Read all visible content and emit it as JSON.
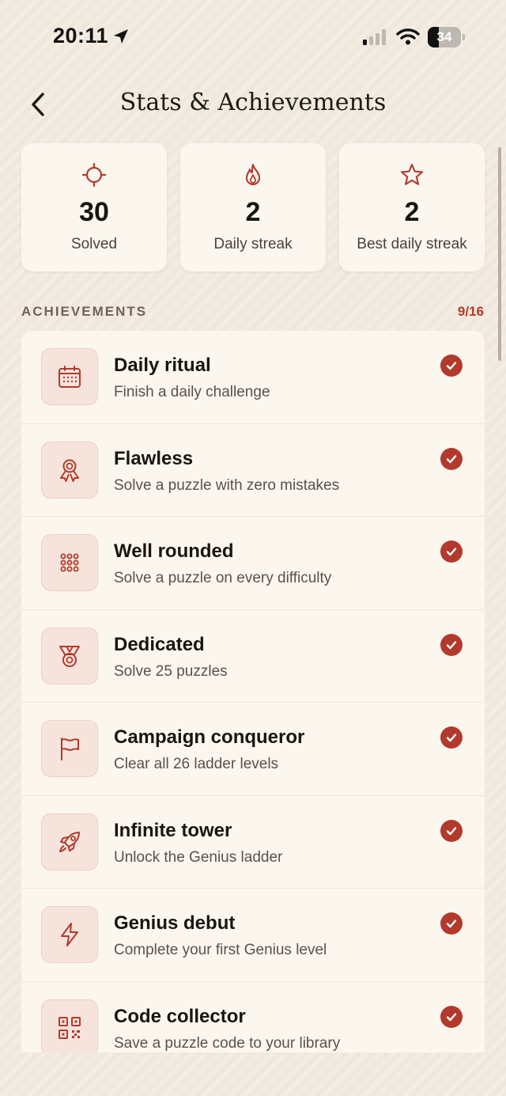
{
  "status_bar": {
    "time": "20:11",
    "battery": "34",
    "battery_level": 0.34
  },
  "header": {
    "title": "Stats & Achievements"
  },
  "stats": [
    {
      "icon": "crosshair-icon",
      "value": "30",
      "label": "Solved"
    },
    {
      "icon": "flame-icon",
      "value": "2",
      "label": "Daily streak"
    },
    {
      "icon": "star-icon",
      "value": "2",
      "label": "Best daily streak"
    }
  ],
  "achievements": {
    "section_title": "ACHIEVEMENTS",
    "count": "9/16",
    "items": [
      {
        "icon": "calendar-icon",
        "title": "Daily ritual",
        "description": "Finish a daily challenge",
        "completed": true
      },
      {
        "icon": "ribbon-award-icon",
        "title": "Flawless",
        "description": "Solve a puzzle with zero mistakes",
        "completed": true
      },
      {
        "icon": "dot-grid-icon",
        "title": "Well rounded",
        "description": "Solve a puzzle on every difficulty",
        "completed": true
      },
      {
        "icon": "medal-icon",
        "title": "Dedicated",
        "description": "Solve 25 puzzles",
        "completed": true
      },
      {
        "icon": "flag-icon",
        "title": "Campaign conqueror",
        "description": "Clear all 26 ladder levels",
        "completed": true
      },
      {
        "icon": "rocket-icon",
        "title": "Infinite tower",
        "description": "Unlock the Genius ladder",
        "completed": true
      },
      {
        "icon": "lightning-icon",
        "title": "Genius debut",
        "description": "Complete your first Genius level",
        "completed": true
      },
      {
        "icon": "qr-code-icon",
        "title": "Code collector",
        "description": "Save a puzzle code to your library",
        "completed": true
      }
    ]
  },
  "colors": {
    "accent": "#b23a2c",
    "background": "#f4ece1",
    "card": "#fbf6ee",
    "icon_tile": "#f6e3dc"
  }
}
